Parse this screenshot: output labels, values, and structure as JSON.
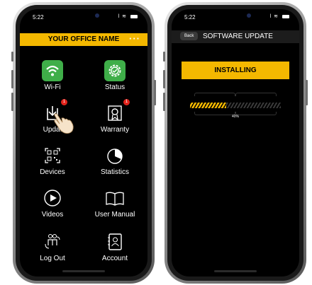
{
  "left_phone": {
    "status": {
      "time": "5:22"
    },
    "header": {
      "office_name": "YOUR OFFICE NAME",
      "menu_label": "···"
    },
    "tiles": [
      {
        "label": "Wi-Fi",
        "icon": "wifi-icon"
      },
      {
        "label": "Status",
        "icon": "gear-icon"
      },
      {
        "label": "Updat",
        "icon": "download-icon",
        "badge": "1"
      },
      {
        "label": "Warranty",
        "icon": "certificate-icon",
        "badge": "1"
      },
      {
        "label": "Devices",
        "icon": "qr-code-icon"
      },
      {
        "label": "Statistics",
        "icon": "pie-chart-icon"
      },
      {
        "label": "Videos",
        "icon": "play-icon"
      },
      {
        "label": "User Manual",
        "icon": "book-icon"
      },
      {
        "label": "Log Out",
        "icon": "users-switch-icon"
      },
      {
        "label": "Account",
        "icon": "contact-book-icon"
      }
    ]
  },
  "right_phone": {
    "status": {
      "time": "5:22"
    },
    "header": {
      "back_label": "Back",
      "title": "SOFTWARE UPDATE"
    },
    "install_button": "INSTALLING",
    "progress": {
      "value": 0.4,
      "label": "40%"
    }
  },
  "colors": {
    "accent": "#f4b800",
    "green": "#3fae49",
    "badge": "#e3231b",
    "screen_bg": "#000000"
  }
}
